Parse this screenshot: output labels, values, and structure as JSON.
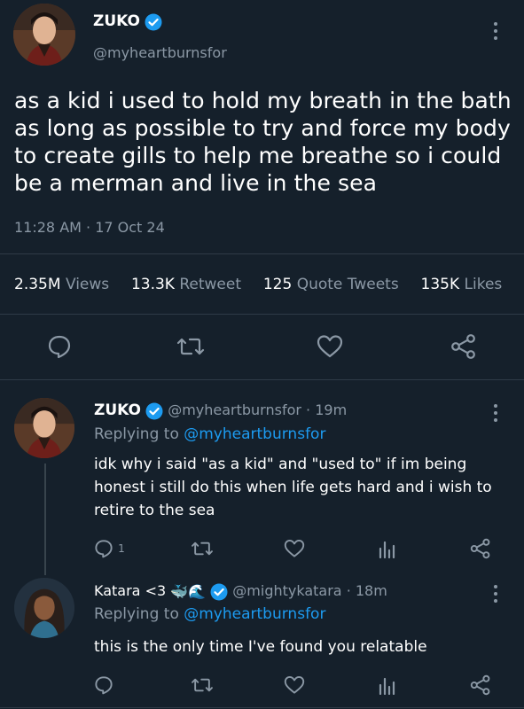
{
  "main_tweet": {
    "author_name": "ZUKO",
    "handle": "@myheartburnsfor",
    "text": "as a kid i used to hold my breath in the bath as long as possible to try and force my body to create gills to help me breathe so i could be a merman and live in the sea",
    "timestamp": "11:28 AM · 17 Oct 24",
    "stats": {
      "views_value": "2.35M",
      "views_label": "Views",
      "retweets_value": "13.3K",
      "retweets_label": "Retweet",
      "quotes_value": "125",
      "quotes_label": "Quote Tweets",
      "likes_value": "135K",
      "likes_label": "Likes"
    }
  },
  "replies": [
    {
      "author_name": "ZUKO",
      "handle_time": "@myheartburnsfor · 19m",
      "replying_prefix": "Replying to",
      "replying_handle": "@myheartburnsfor",
      "text": "idk why i said \"as a kid\" and \"used to\" if im being honest i still do this when life gets hard and i wish to retire to the sea",
      "reply_count": "1"
    },
    {
      "author_name": "Katara <3",
      "name_emojis": "🐳🌊",
      "handle_time": "@mightykatara · 18m",
      "replying_prefix": "Replying to",
      "replying_handle": "@myheartburnsfor",
      "text": "this is the only time I've found you relatable",
      "reply_count": ""
    }
  ],
  "icons": [
    "verified-badge-icon",
    "more-options-icon",
    "reply-icon",
    "retweet-icon",
    "like-icon",
    "share-icon",
    "analytics-icon"
  ],
  "colors": {
    "background": "#15202b",
    "accent": "#1d9bf0",
    "secondary_text": "#8b98a5",
    "divider": "#2f3b47"
  }
}
